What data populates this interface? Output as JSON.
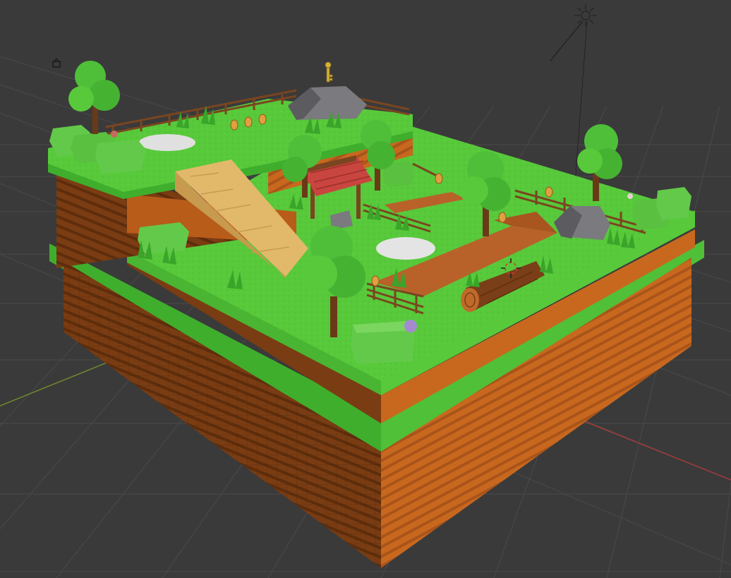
{
  "viewport": {
    "mode": "3d-viewport",
    "shading": "rendered",
    "colors": {
      "background": "#3a3a3a",
      "grid_line": "#4a4a4a",
      "axis_x": "#a33a3a",
      "axis_y": "#6f8a2c",
      "grass_top": "#57c93a",
      "grass_side": "#3fae2d",
      "dirt": "#c8681e",
      "dirt_dark": "#7a3c12",
      "path": "#b8622a",
      "ramp": "#e2b86a",
      "tree": "#4fbf3a",
      "trunk": "#6a3a18",
      "rock": "#7a7a7f",
      "fence": "#7a4520",
      "roof": "#c9453f",
      "coin": "#e0a040",
      "key": "#d6b23a"
    }
  },
  "scene_objects": [
    "terrain-block",
    "upper-plateau",
    "wooden-ramp",
    "roofed-shrine",
    "log",
    "rock",
    "tree",
    "bush",
    "fence",
    "coin",
    "key",
    "flower-patch",
    "sun-lamp",
    "camera"
  ]
}
